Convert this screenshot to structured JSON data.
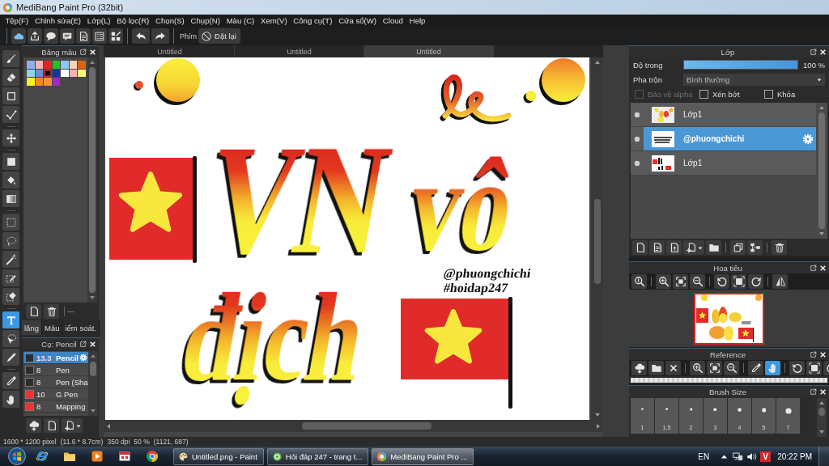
{
  "window": {
    "title": "MediBang Paint Pro (32bit)"
  },
  "menu": [
    "Tệp(F)",
    "Chỉnh sửa(E)",
    "Lớp(L)",
    "Bộ lọc(R)",
    "Chọn(S)",
    "Chụp(N)",
    "Màu (C)",
    "Xem(V)",
    "Công cụ(T)",
    "Cửa sổ(W)",
    "Cloud",
    "Help"
  ],
  "toolbar": {
    "key_label": "Phím",
    "reset_button": "Đặt lại"
  },
  "tool_groups": [
    [
      {
        "selected": false
      },
      {
        "selected": false
      },
      {
        "selected": false
      },
      {
        "selected": false
      }
    ],
    [
      {
        "selected": false
      }
    ],
    [
      {
        "selected": false
      },
      {
        "selected": false
      },
      {
        "selected": false
      }
    ],
    [
      {
        "selected": false
      },
      {
        "selected": false
      },
      {
        "selected": false
      },
      {
        "selected": false
      },
      {
        "selected": false
      }
    ],
    [
      {
        "selected": true
      },
      {
        "selected": false
      },
      {
        "selected": false
      }
    ],
    [
      {
        "selected": false
      },
      {
        "selected": false
      }
    ]
  ],
  "palette": {
    "title": "Bảng màu",
    "swatches": [
      {
        "color": "#8db0e8",
        "selected": false
      },
      {
        "color": "#f4b4b4",
        "selected": false
      },
      {
        "color": "#e02424",
        "selected": false
      },
      {
        "color": "#22c022",
        "selected": false
      },
      {
        "color": "#8cc8f4",
        "selected": false
      },
      {
        "color": "#f4d4b4",
        "selected": false
      },
      {
        "color": "#e06010",
        "selected": false
      },
      {
        "color": "#8cd4f4",
        "selected": false
      },
      {
        "color": "#6c8ce0",
        "selected": false
      },
      {
        "color": "#000000",
        "selected": true
      },
      {
        "color": "#1434a8",
        "selected": false
      },
      {
        "color": "#ffffff",
        "selected": false
      },
      {
        "color": "#f8b4b4",
        "selected": false
      },
      {
        "color": "#f8f878",
        "selected": false
      },
      {
        "color": "#f8f020",
        "selected": false
      },
      {
        "color": "#f08830",
        "selected": false
      },
      {
        "color": "#f89040",
        "selected": false
      },
      {
        "color": "#a424d0",
        "selected": false
      }
    ],
    "footer_label": "---",
    "tabs": [
      {
        "label": "lăng",
        "selected": true
      },
      {
        "label": "Màu",
        "selected": false
      },
      {
        "label": "iểm soát.",
        "selected": false
      }
    ]
  },
  "brushes": {
    "title": "Cọ: Pencil",
    "items": [
      {
        "size": "13.3",
        "name": "Pencil",
        "color": "#2e2e2e",
        "selected": true
      },
      {
        "size": "8",
        "name": "Pen",
        "color": "#2e2e2e",
        "selected": false
      },
      {
        "size": "8",
        "name": "Pen (Sha",
        "color": "#2e2e2e",
        "selected": false
      },
      {
        "size": "10",
        "name": "G Pen",
        "color": "#e83434",
        "selected": false
      },
      {
        "size": "8",
        "name": "Mapping",
        "color": "#e83434",
        "selected": false
      }
    ]
  },
  "canvas": {
    "tabs": [
      {
        "label": "Untitled",
        "selected": false
      },
      {
        "label": "Untitled",
        "selected": false
      },
      {
        "label": "Untitled",
        "selected": true
      }
    ],
    "artwork": [
      {
        "kind": "lettering",
        "text": "VN"
      },
      {
        "kind": "lettering",
        "text": "vô"
      },
      {
        "kind": "lettering",
        "text": "địch"
      },
      {
        "kind": "signature",
        "text": "@phuongchichi"
      },
      {
        "kind": "signature",
        "text": "#hoidap247"
      }
    ]
  },
  "layers": {
    "title": "Lớp",
    "opacity": {
      "label": "Độ trong",
      "level": 1,
      "reading": "100 %"
    },
    "blend": {
      "label": "Pha trộn",
      "value": "Bình thường"
    },
    "options": [
      {
        "label": "Bảo vệ alpha",
        "checked": false,
        "disabled": true
      },
      {
        "label": "Xén bớt",
        "checked": false,
        "disabled": false
      },
      {
        "label": "Khóa",
        "checked": false,
        "disabled": false
      }
    ],
    "items": [
      {
        "name": "Lớp1",
        "selected": false
      },
      {
        "name": "@phuongchichi",
        "selected": true
      },
      {
        "name": "Lớp1",
        "selected": false
      }
    ]
  },
  "navigator": {
    "title": "Hoa tiêu"
  },
  "reference": {
    "title": "Reference",
    "tools": [
      {
        "selected": false
      },
      {
        "selected": false
      },
      {
        "selected": false
      },
      {
        "selected": false
      },
      {
        "selected": false
      },
      {
        "selected": false
      },
      {
        "selected": false
      },
      {
        "selected": true
      },
      {
        "selected": false
      },
      {
        "selected": false
      },
      {
        "selected": false
      }
    ]
  },
  "brush_size": {
    "title": "Brush Size",
    "sizes": [
      "1",
      "1.5",
      "2",
      "3",
      "4",
      "5",
      "7"
    ]
  },
  "status_bar": [
    "1600 * 1200 pixel",
    "(11.6 * 8.7cm)",
    "350 dpi",
    "50 %",
    "(1121, 687)"
  ],
  "taskbar": {
    "tasks": [
      {
        "label": "Untitled.png - Paint",
        "selected": false
      },
      {
        "label": "Hỏi đáp 247 - trang t...",
        "selected": false
      },
      {
        "label": "MediBang Paint Pro ...",
        "selected": true
      }
    ],
    "language": "EN",
    "tray_badge": "V",
    "time": "20:22 PM"
  }
}
